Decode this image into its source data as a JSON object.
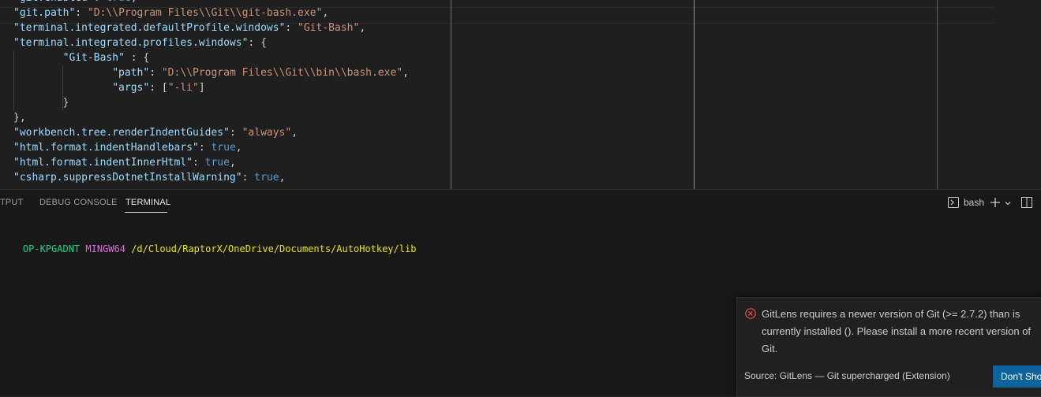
{
  "editor": {
    "lines": [
      [
        {
          "c": "k",
          "t": "\"git.enabled\""
        },
        {
          "c": "p",
          "t": ": "
        },
        {
          "c": "b",
          "t": "true"
        },
        {
          "c": "p",
          "t": ","
        }
      ],
      [
        {
          "c": "k",
          "t": "\"git.path\""
        },
        {
          "c": "p",
          "t": ": "
        },
        {
          "c": "s",
          "t": "\"D:\\\\Program Files\\\\Git\\\\git-bash.exe\""
        },
        {
          "c": "p",
          "t": ","
        }
      ],
      [
        {
          "c": "k",
          "t": "\"terminal.integrated.defaultProfile.windows\""
        },
        {
          "c": "p",
          "t": ": "
        },
        {
          "c": "s",
          "t": "\"Git-Bash\""
        },
        {
          "c": "p",
          "t": ","
        }
      ],
      [
        {
          "c": "k",
          "t": "\"terminal.integrated.profiles.windows\""
        },
        {
          "c": "p",
          "t": ": {"
        }
      ],
      [
        {
          "c": "p",
          "t": "        "
        },
        {
          "c": "k",
          "t": "\"Git-Bash\""
        },
        {
          "c": "p",
          "t": " : {"
        }
      ],
      [
        {
          "c": "p",
          "t": "                "
        },
        {
          "c": "k",
          "t": "\"path\""
        },
        {
          "c": "p",
          "t": ": "
        },
        {
          "c": "s",
          "t": "\"D:\\\\Program Files\\\\Git\\\\bin\\\\bash.exe\""
        },
        {
          "c": "p",
          "t": ","
        }
      ],
      [
        {
          "c": "p",
          "t": "                "
        },
        {
          "c": "k",
          "t": "\"args\""
        },
        {
          "c": "p",
          "t": ": ["
        },
        {
          "c": "s",
          "t": "\"-li\""
        },
        {
          "c": "p",
          "t": "]"
        }
      ],
      [
        {
          "c": "p",
          "t": "        }"
        }
      ],
      [
        {
          "c": "p",
          "t": "},"
        }
      ],
      [
        {
          "c": "k",
          "t": "\"workbench.tree.renderIndentGuides\""
        },
        {
          "c": "p",
          "t": ": "
        },
        {
          "c": "s",
          "t": "\"always\""
        },
        {
          "c": "p",
          "t": ","
        }
      ],
      [
        {
          "c": "k",
          "t": "\"html.format.indentHandlebars\""
        },
        {
          "c": "p",
          "t": ": "
        },
        {
          "c": "b",
          "t": "true"
        },
        {
          "c": "p",
          "t": ","
        }
      ],
      [
        {
          "c": "k",
          "t": "\"html.format.indentInnerHtml\""
        },
        {
          "c": "p",
          "t": ": "
        },
        {
          "c": "b",
          "t": "true"
        },
        {
          "c": "p",
          "t": ","
        }
      ],
      [
        {
          "c": "k",
          "t": "\"csharp.suppressDotnetInstallWarning\""
        },
        {
          "c": "p",
          "t": ": "
        },
        {
          "c": "b",
          "t": "true"
        },
        {
          "c": "p",
          "t": ","
        }
      ]
    ],
    "rulers": [
      "#23d18b",
      "#e5c07b",
      "#e05252"
    ]
  },
  "panel": {
    "tabs": [
      "TPUT",
      "DEBUG CONSOLE",
      "TERMINAL"
    ],
    "active_tab": "TERMINAL",
    "terminal_name": "bash",
    "icons": [
      "terminal-icon",
      "plus-icon",
      "chevron-down-icon",
      "split-icon"
    ],
    "prompt": {
      "host": "OP-KPGADNT",
      "system": "MINGW64",
      "path": "/d/Cloud/RaptorX/OneDrive/Documents/AutoHotkey/lib"
    }
  },
  "notification": {
    "message": "GitLens requires a newer version of Git (>= 2.7.2) than is currently installed (). Please install a more recent version of Git.",
    "source": "Source: GitLens — Git supercharged (Extension)",
    "button": "Don't Show",
    "icon": "error-icon"
  }
}
